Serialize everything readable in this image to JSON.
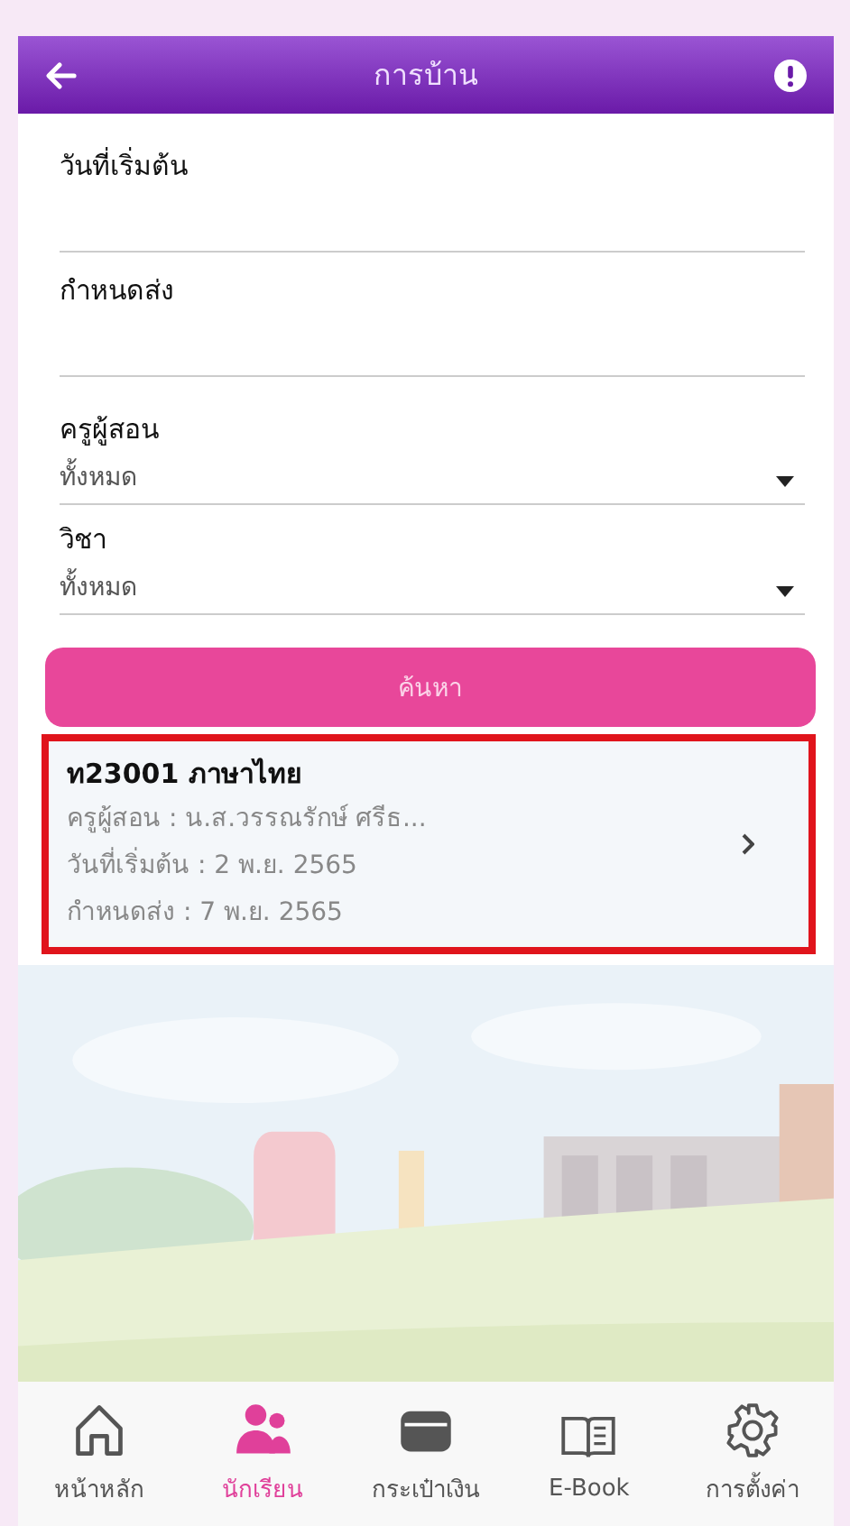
{
  "header": {
    "title": "การบ้าน"
  },
  "date_fields": [
    {
      "label": "วันที่เริ่มต้น"
    },
    {
      "label": "กำหนดส่ง"
    }
  ],
  "select_fields": [
    {
      "label": "ครูผู้สอน",
      "value": "ทั้งหมด"
    },
    {
      "label": "วิชา",
      "value": "ทั้งหมด"
    }
  ],
  "search_button": "ค้นหา",
  "results": [
    {
      "title": "ท23001 ภาษาไทย",
      "highlighted": true,
      "lines": [
        "ครูผู้สอน : น.ส.วรรณรักษ์ ศรีธ...",
        "วันที่เริ่มต้น : 2 พ.ย. 2565",
        "กำหนดส่ง : 7 พ.ย. 2565"
      ]
    }
  ],
  "nav": [
    {
      "label": "หน้าหลัก",
      "kind": "home",
      "selected": false
    },
    {
      "label": "นักเรียน",
      "kind": "students",
      "selected": true
    },
    {
      "label": "กระเป๋าเงิน",
      "kind": "wallet",
      "selected": false
    },
    {
      "label": "E-Book",
      "kind": "book",
      "selected": false
    },
    {
      "label": "การตั้งค่า",
      "kind": "gear",
      "selected": false
    }
  ]
}
